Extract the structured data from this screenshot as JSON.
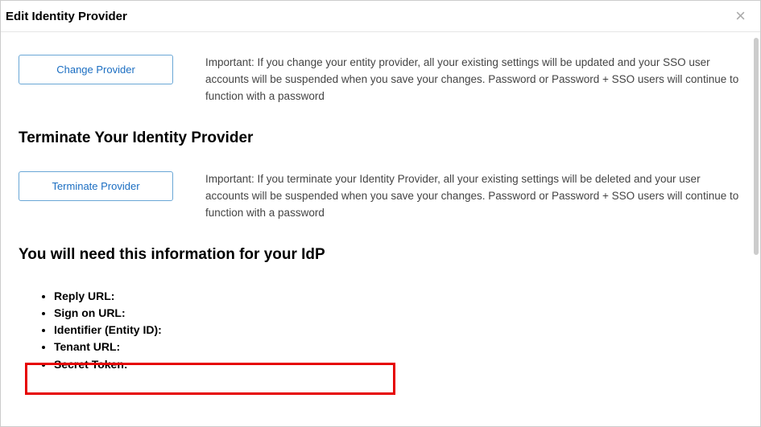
{
  "header": {
    "title": "Edit Identity Provider"
  },
  "change": {
    "button": "Change Provider",
    "desc": "Important: If you change your entity provider, all your existing settings will be updated and your SSO user accounts will be suspended when you save your changes. Password or Password + SSO users will continue to function with a password"
  },
  "terminate": {
    "heading": "Terminate Your Identity Provider",
    "button": "Terminate Provider",
    "desc": "Important: If you terminate your Identity Provider, all your existing settings will be deleted and your user accounts will be suspended when you save your changes. Password or Password + SSO users will continue to function with a password"
  },
  "idp_info": {
    "heading": "You will need this information for your IdP",
    "items": {
      "0": "Reply URL:",
      "1": "Sign on URL:",
      "2": "Identifier (Entity ID):",
      "3": "Tenant URL:",
      "4": "Secret Token:"
    }
  }
}
